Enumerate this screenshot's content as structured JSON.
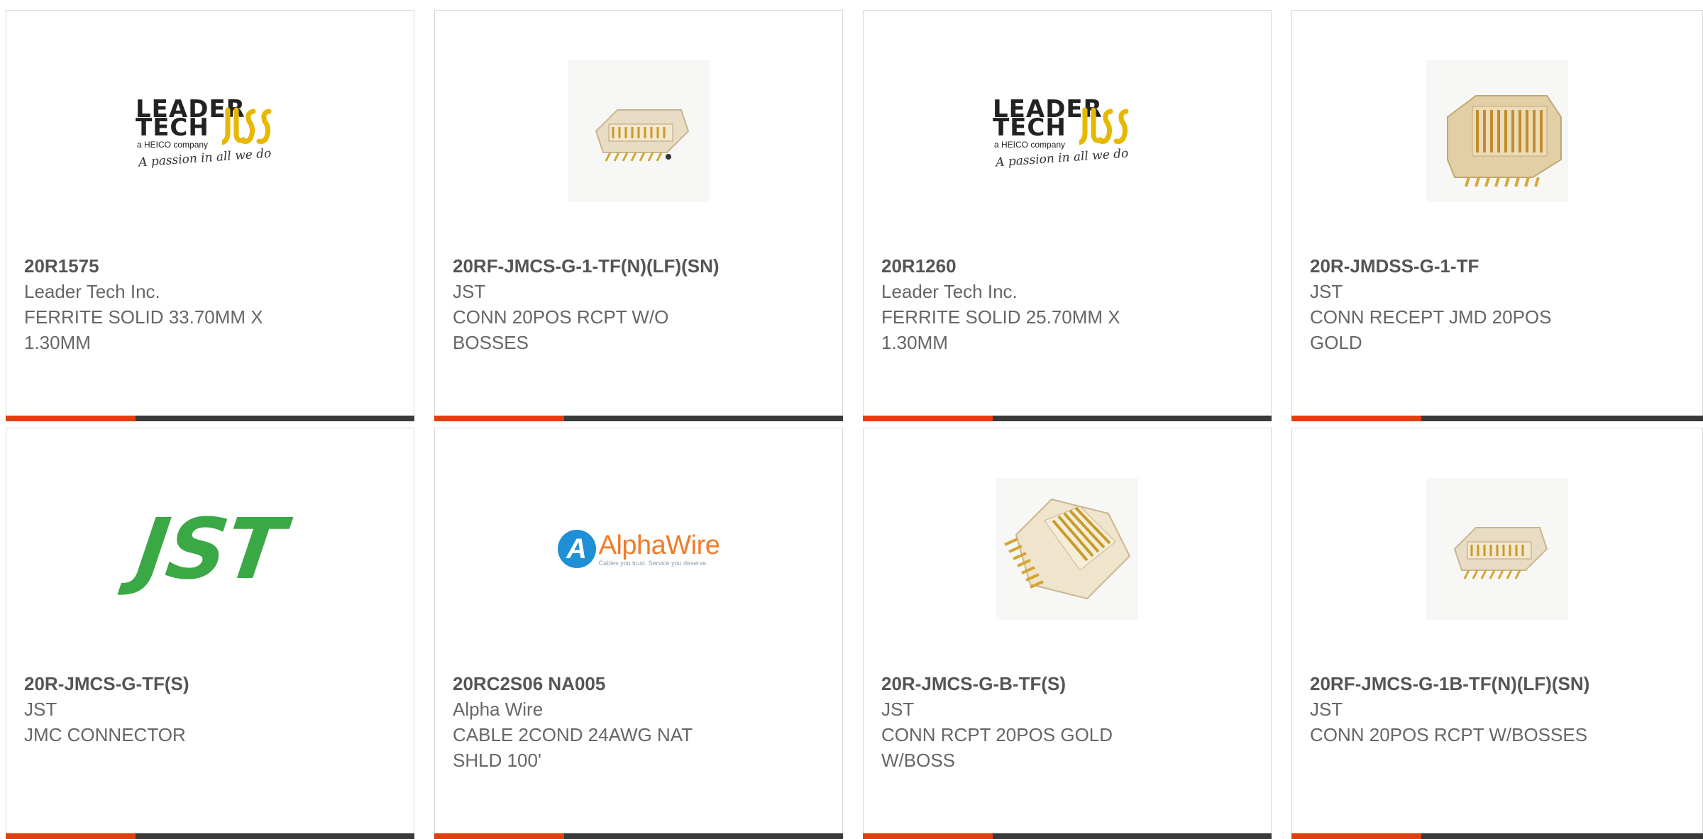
{
  "products": [
    {
      "part_number": "20R1575",
      "manufacturer": "Leader Tech Inc.",
      "description": [
        "FERRITE SOLID 33.70MM X",
        "1.30MM"
      ],
      "image": "leader-tech-logo"
    },
    {
      "part_number": "20RF-JMCS-G-1-TF(N)(LF)(SN)",
      "manufacturer": "JST",
      "description": [
        "CONN 20POS RCPT W/O",
        "BOSSES"
      ],
      "image": "connector-photo"
    },
    {
      "part_number": "20R1260",
      "manufacturer": "Leader Tech Inc.",
      "description": [
        "FERRITE SOLID 25.70MM X",
        "1.30MM"
      ],
      "image": "leader-tech-logo"
    },
    {
      "part_number": "20R-JMDSS-G-1-TF",
      "manufacturer": "JST",
      "description": [
        "CONN RECEPT JMD 20POS",
        "GOLD"
      ],
      "image": "connector-photo"
    },
    {
      "part_number": "20R-JMCS-G-TF(S)",
      "manufacturer": "JST",
      "description": [
        "JMC CONNECTOR"
      ],
      "image": "jst-logo"
    },
    {
      "part_number": "20RC2S06 NA005",
      "manufacturer": "Alpha Wire",
      "description": [
        "CABLE 2COND 24AWG NAT",
        "SHLD 100'"
      ],
      "image": "alphawire-logo"
    },
    {
      "part_number": "20R-JMCS-G-B-TF(S)",
      "manufacturer": "JST",
      "description": [
        "CONN RCPT 20POS GOLD",
        "W/BOSS"
      ],
      "image": "connector-photo"
    },
    {
      "part_number": "20RF-JMCS-G-1B-TF(N)(LF)(SN)",
      "manufacturer": "JST",
      "description": [
        "CONN 20POS RCPT W/BOSSES"
      ],
      "image": "connector-photo"
    }
  ],
  "logos": {
    "leader_tech": {
      "line1": "LEADER",
      "line2": "TECH",
      "heico": "a HEICO company",
      "tagline": "A passion in all we do"
    },
    "jst": {
      "text": "JST"
    },
    "alphawire": {
      "mark": "A",
      "name": "AlphaWire",
      "tagline": "Cables you trust. Service you deserve."
    }
  },
  "colors": {
    "accent": "#e0400e",
    "bar": "#3a3a3a",
    "text": "#666666",
    "jst_green": "#3aa845",
    "alphawire_orange": "#f07c2a",
    "alphawire_blue": "#1f8fd6",
    "leader_yellow": "#e6b800"
  }
}
